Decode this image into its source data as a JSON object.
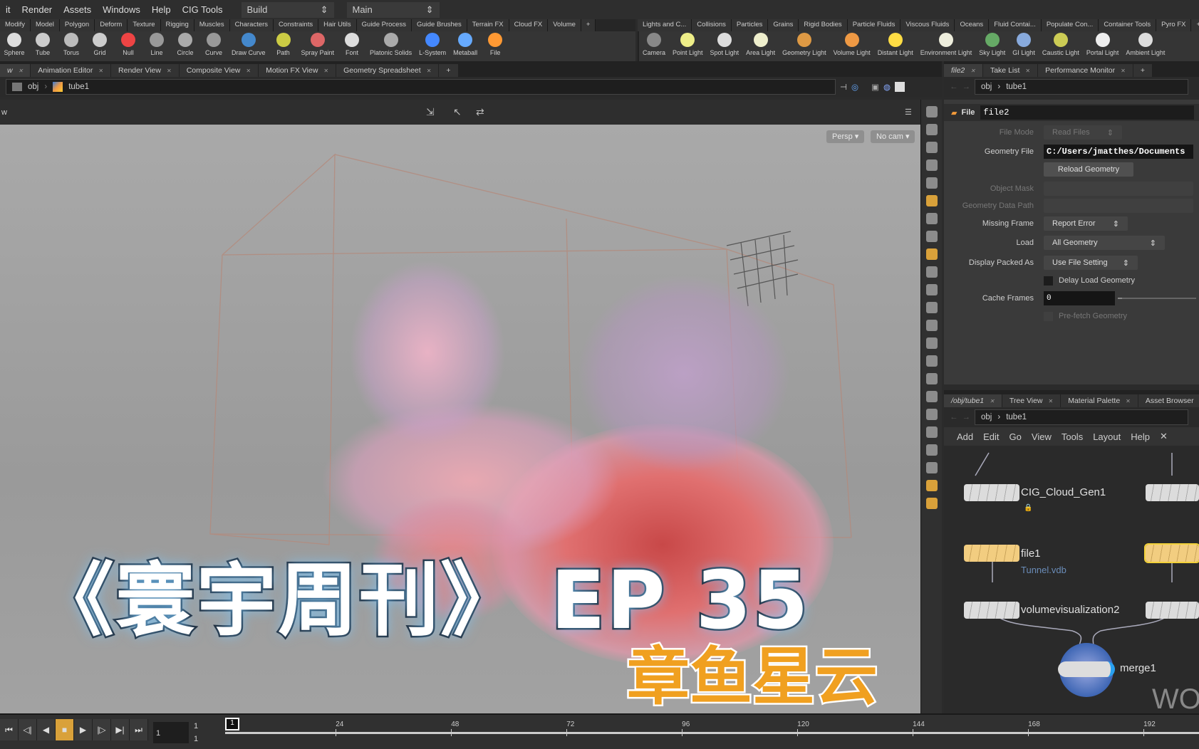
{
  "menu": [
    "it",
    "Render",
    "Assets",
    "Windows",
    "Help",
    "CIG Tools"
  ],
  "desktop": {
    "build": "Build",
    "main": "Main"
  },
  "shelf_left_tabs": [
    "Modify",
    "Model",
    "Polygon",
    "Deform",
    "Texture",
    "Rigging",
    "Muscles",
    "Characters",
    "Constraints",
    "Hair Utils",
    "Guide Process",
    "Guide Brushes",
    "Terrain FX",
    "Cloud FX",
    "Volume"
  ],
  "shelf_left_tools": [
    "Sphere",
    "Tube",
    "Torus",
    "Grid",
    "Null",
    "Line",
    "Circle",
    "Curve",
    "Draw Curve",
    "Path",
    "Spray Paint",
    "Font",
    "Platonic Solids",
    "L-System",
    "Metaball",
    "File"
  ],
  "shelf_right_tabs": [
    "Lights and C...",
    "Collisions",
    "Particles",
    "Grains",
    "Rigid Bodies",
    "Particle Fluids",
    "Viscous Fluids",
    "Oceans",
    "Fluid Contai...",
    "Populate Con...",
    "Container Tools",
    "Pyro FX"
  ],
  "shelf_right_tools": [
    "Camera",
    "Point Light",
    "Spot Light",
    "Area Light",
    "Geometry Light",
    "Volume Light",
    "Distant Light",
    "Environment Light",
    "Sky Light",
    "GI Light",
    "Caustic Light",
    "Portal Light",
    "Ambient Light"
  ],
  "pane_tabs": [
    "w",
    "Animation Editor",
    "Render View",
    "Composite View",
    "Motion FX View",
    "Geometry Spreadsheet"
  ],
  "path": {
    "root": "obj",
    "node": "tube1"
  },
  "viewport": {
    "title": "w",
    "persp": "Persp ▾",
    "cam": "No cam ▾"
  },
  "overlay": {
    "title": "《寰宇周刊》 EP 35",
    "subtitle": "章鱼星云"
  },
  "param_tabs": [
    "file2",
    "Take List",
    "Performance Monitor"
  ],
  "params": {
    "type": "File",
    "name": "file2",
    "file_mode_label": "File Mode",
    "file_mode": "Read Files",
    "geometry_file_label": "Geometry File",
    "geometry_file": "C:/Users/jmatthes/Documents",
    "reload": "Reload Geometry",
    "object_mask_label": "Object Mask",
    "geometry_data_path_label": "Geometry Data Path",
    "missing_frame_label": "Missing Frame",
    "missing_frame": "Report Error",
    "load_label": "Load",
    "load": "All Geometry",
    "display_packed_label": "Display Packed As",
    "display_packed": "Use File Setting",
    "delay_load": "Delay Load Geometry",
    "cache_frames_label": "Cache Frames",
    "cache_frames": "0",
    "prefetch": "Pre-fetch Geometry"
  },
  "network_tabs": [
    "/obj/tube1",
    "Tree View",
    "Material Palette",
    "Asset Browser"
  ],
  "network_menu": [
    "Add",
    "Edit",
    "Go",
    "View",
    "Tools",
    "Layout",
    "Help"
  ],
  "nodes": {
    "cloud": "CIG_Cloud_Gen1",
    "file": "file1",
    "file_sub": "Tunnel.vdb",
    "vis": "volumevisualization2",
    "merge": "merge1"
  },
  "watermark": "WOR",
  "timeline": {
    "frame": "1",
    "start": "1",
    "end": "1",
    "current_marker": "1",
    "ticks": [
      "24",
      "48",
      "72",
      "96",
      "120",
      "144",
      "168",
      "192"
    ]
  },
  "colors": {
    "accent": "#d9a13a",
    "subtitle": "#f0a020",
    "file_node": "#f2cd80"
  }
}
